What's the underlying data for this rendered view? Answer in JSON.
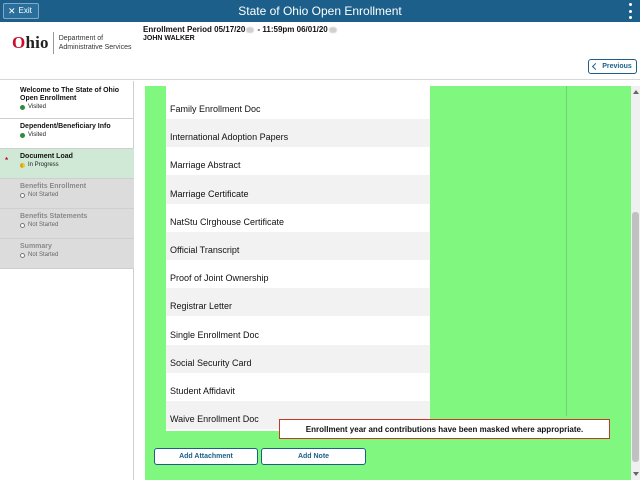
{
  "topbar": {
    "exit_label": "Exit",
    "title": "State of Ohio Open Enrollment"
  },
  "header": {
    "logo_word_first": "O",
    "logo_word_rest": "hio",
    "logo_dept_line1": "Department of",
    "logo_dept_line2": "Administrative Services",
    "period_prefix": "Enrollment Period 05/17/20",
    "period_middle": " - 11:59pm 06/01/20",
    "user_name": "JOHN WALKER",
    "previous_label": "Previous"
  },
  "sidebar": {
    "steps": [
      {
        "title": "Welcome to The State of Ohio Open Enrollment",
        "status": "Visited"
      },
      {
        "title": "Dependent/Beneficiary Info",
        "status": "Visited"
      },
      {
        "title": "Document Load",
        "status": "In Progress"
      },
      {
        "title": "Benefits Enrollment",
        "status": "Not Started"
      },
      {
        "title": "Benefits Statements",
        "status": "Not Started"
      },
      {
        "title": "Summary",
        "status": "Not Started"
      }
    ]
  },
  "documents": [
    "Family Enrollment Doc",
    "International Adoption Papers",
    "Marriage Abstract",
    "Marriage Certificate",
    "NatStu Clrghouse Certificate",
    "Official Transcript",
    "Proof of Joint Ownership",
    "Registrar Letter",
    "Single Enrollment Doc",
    "Social Security Card",
    "Student Affidavit",
    "Waive Enrollment Doc"
  ],
  "notice": "Enrollment year and contributions have been masked where appropriate.",
  "actions": {
    "add_attachment": "Add Attachment",
    "add_note": "Add Note"
  }
}
